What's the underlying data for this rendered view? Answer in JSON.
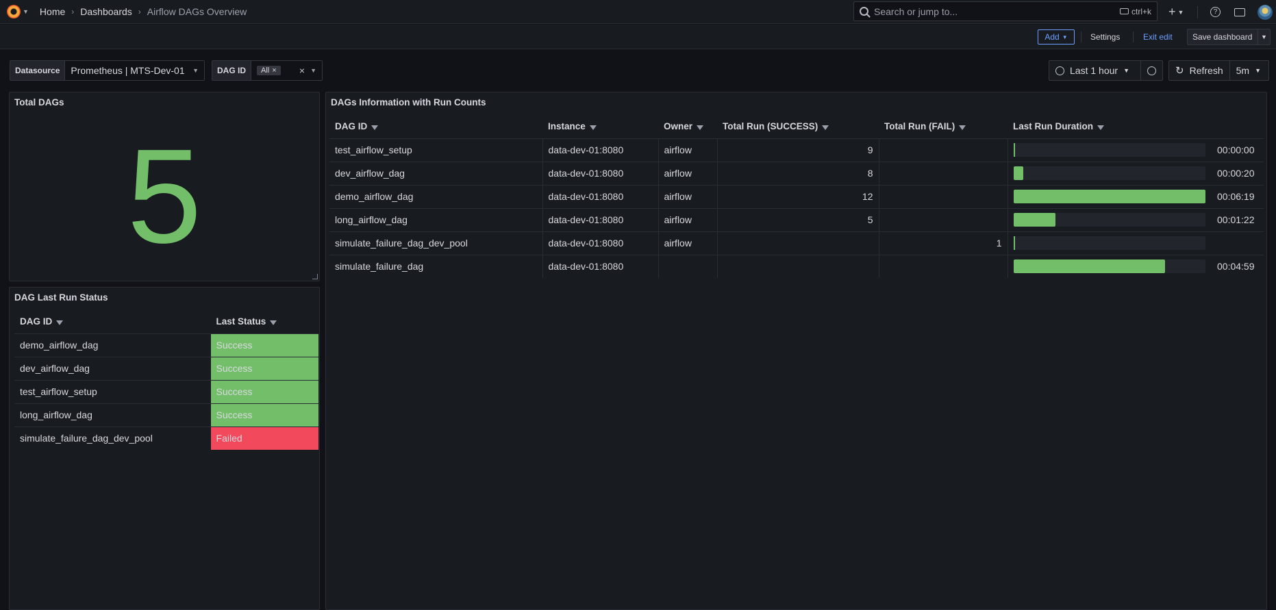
{
  "nav": {
    "breadcrumbs": [
      "Home",
      "Dashboards",
      "Airflow DAGs Overview"
    ],
    "search_placeholder": "Search or jump to...",
    "search_shortcut": "ctrl+k",
    "plus": "+"
  },
  "editbar": {
    "add_label": "Add",
    "settings_label": "Settings",
    "exit_label": "Exit edit",
    "save_label": "Save dashboard"
  },
  "variables": {
    "datasource_label": "Datasource",
    "datasource_value": "Prometheus | MTS-Dev-01",
    "dagid_label": "DAG ID",
    "dagid_chip": "All"
  },
  "time": {
    "range": "Last 1 hour",
    "refresh_label": "Refresh",
    "interval": "5m"
  },
  "total_dags": {
    "title": "Total DAGs",
    "value": "5"
  },
  "status_panel": {
    "title": "DAG Last Run Status",
    "columns": [
      "DAG ID",
      "Last Status"
    ],
    "rows": [
      {
        "dag": "demo_airflow_dag",
        "status": "Success",
        "kind": "ok"
      },
      {
        "dag": "dev_airflow_dag",
        "status": "Success",
        "kind": "ok"
      },
      {
        "dag": "test_airflow_setup",
        "status": "Success",
        "kind": "ok"
      },
      {
        "dag": "long_airflow_dag",
        "status": "Success",
        "kind": "ok"
      },
      {
        "dag": "simulate_failure_dag_dev_pool",
        "status": "Failed",
        "kind": "fail"
      }
    ]
  },
  "info_panel": {
    "title": "DAGs Information with Run Counts",
    "columns": [
      "DAG ID",
      "Instance",
      "Owner",
      "Total Run (SUCCESS)",
      "Total Run (FAIL)",
      "Last Run Duration"
    ],
    "rows": [
      {
        "dag": "test_airflow_setup",
        "instance": "data-dev-01:8080",
        "owner": "airflow",
        "success": "9",
        "fail": "",
        "duration": "00:00:00",
        "fraction": 0.0
      },
      {
        "dag": "dev_airflow_dag",
        "instance": "data-dev-01:8080",
        "owner": "airflow",
        "success": "8",
        "fail": "",
        "duration": "00:00:20",
        "fraction": 0.05
      },
      {
        "dag": "demo_airflow_dag",
        "instance": "data-dev-01:8080",
        "owner": "airflow",
        "success": "12",
        "fail": "",
        "duration": "00:06:19",
        "fraction": 1.0
      },
      {
        "dag": "long_airflow_dag",
        "instance": "data-dev-01:8080",
        "owner": "airflow",
        "success": "5",
        "fail": "",
        "duration": "00:01:22",
        "fraction": 0.22
      },
      {
        "dag": "simulate_failure_dag_dev_pool",
        "instance": "data-dev-01:8080",
        "owner": "airflow",
        "success": "",
        "fail": "1",
        "duration": "",
        "fraction": 0.0
      },
      {
        "dag": "simulate_failure_dag",
        "instance": "data-dev-01:8080",
        "owner": "",
        "success": "",
        "fail": "",
        "duration": "00:04:59",
        "fraction": 0.79
      }
    ]
  }
}
